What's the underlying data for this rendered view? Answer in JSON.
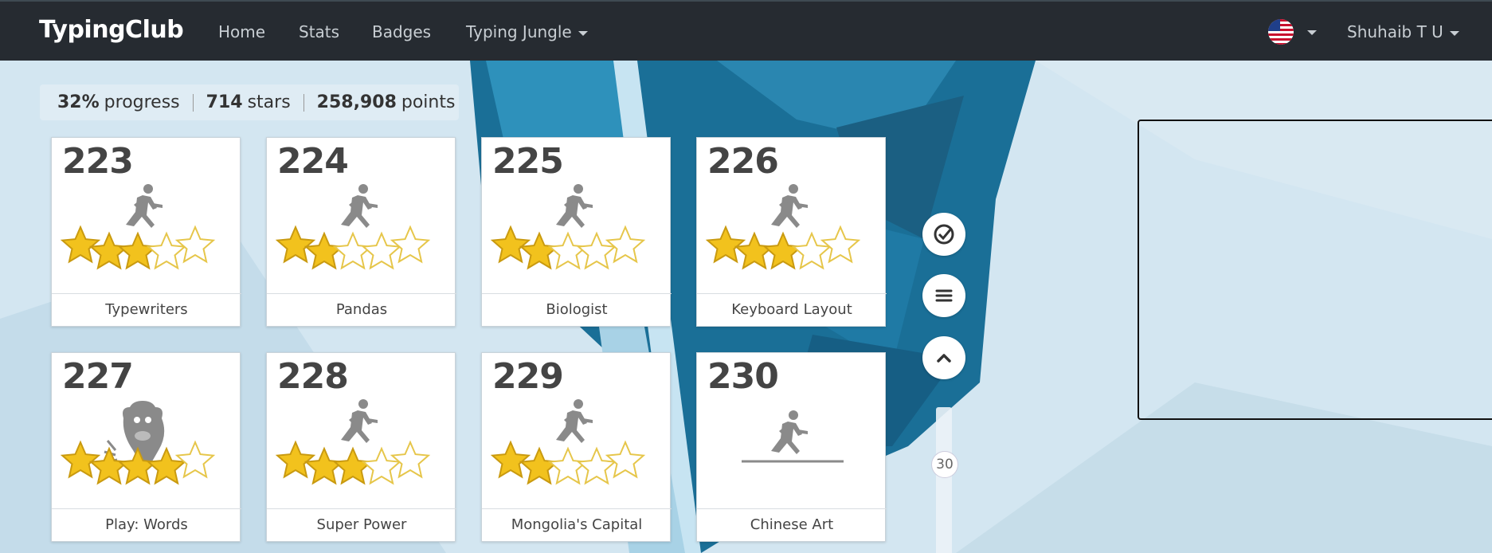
{
  "navbar": {
    "brand": "TypingClub",
    "links": [
      "Home",
      "Stats",
      "Badges",
      "Typing Jungle"
    ],
    "user": "Shuhaib T U"
  },
  "progress": {
    "percent": "32%",
    "percent_label": "progress",
    "stars": "714",
    "stars_label": "stars",
    "points": "258,908",
    "points_label": "points"
  },
  "lessons": [
    {
      "number": "223",
      "title": "Typewriters",
      "stars": 3,
      "icon": "runner-icon"
    },
    {
      "number": "224",
      "title": "Pandas",
      "stars": 2,
      "icon": "runner-icon"
    },
    {
      "number": "225",
      "title": "Biologist",
      "stars": 2,
      "icon": "runner-icon"
    },
    {
      "number": "226",
      "title": "Keyboard Layout",
      "stars": 3,
      "icon": "runner-icon"
    },
    {
      "number": "227",
      "title": "Play: Words",
      "stars": 4,
      "icon": "monster-icon"
    },
    {
      "number": "228",
      "title": "Super Power",
      "stars": 3,
      "icon": "runner-icon"
    },
    {
      "number": "229",
      "title": "Mongolia's Capital",
      "stars": 2,
      "icon": "runner-icon"
    },
    {
      "number": "230",
      "title": "Chinese Art",
      "stars": 0,
      "icon": "runner-icon"
    }
  ],
  "scroll_level": "30",
  "colors": {
    "navbar": "#262b31",
    "star": "#f2c21d"
  }
}
